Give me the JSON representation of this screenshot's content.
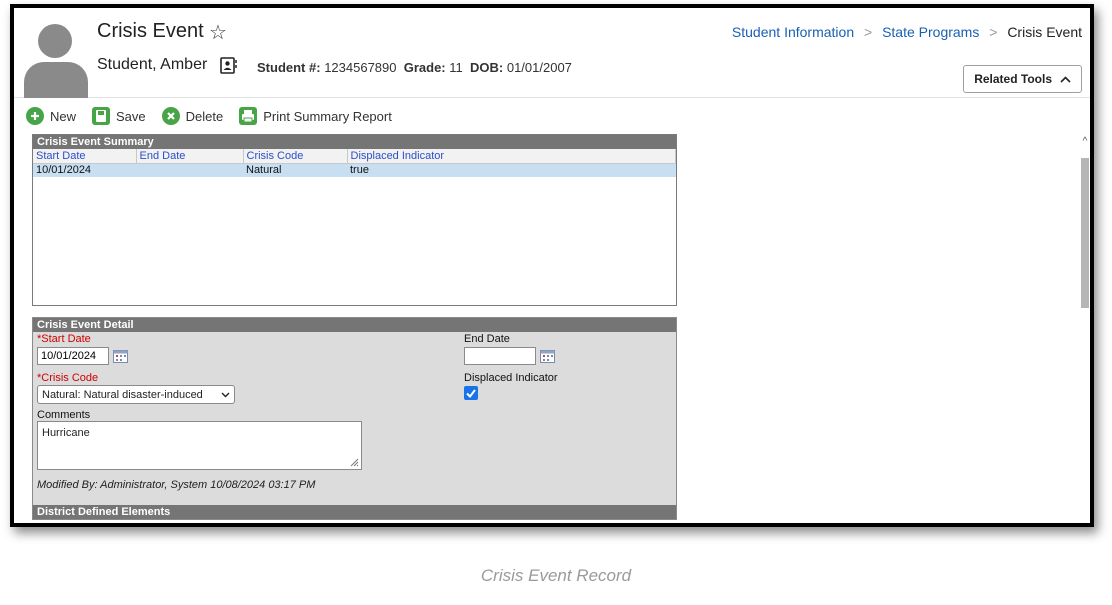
{
  "header": {
    "page_title": "Crisis Event",
    "student_name": "Student, Amber",
    "student_number_label": "Student #:",
    "student_number": "1234567890",
    "grade_label": "Grade:",
    "grade": "11",
    "dob_label": "DOB:",
    "dob": "01/01/2007",
    "breadcrumb": [
      "Student Information",
      "State Programs",
      "Crisis Event"
    ],
    "related_tools_label": "Related Tools"
  },
  "toolbar": {
    "new_label": "New",
    "save_label": "Save",
    "delete_label": "Delete",
    "print_label": "Print Summary Report"
  },
  "summary": {
    "title": "Crisis Event Summary",
    "columns": [
      "Start Date",
      "End Date",
      "Crisis Code",
      "Displaced Indicator"
    ],
    "rows": [
      [
        "10/01/2024",
        "",
        "Natural",
        "true"
      ]
    ]
  },
  "detail": {
    "title": "Crisis Event Detail",
    "start_date_label": "*Start Date",
    "start_date_value": "10/01/2024",
    "end_date_label": "End Date",
    "end_date_value": "",
    "crisis_code_label": "*Crisis Code",
    "crisis_code_value": "Natural: Natural disaster-induced",
    "displaced_label": "Displaced Indicator",
    "displaced_checked": true,
    "comments_label": "Comments",
    "comments_value": "Hurricane",
    "modified_by": "Modified By: Administrator, System 10/08/2024 03:17 PM",
    "district_title": "District Defined Elements"
  },
  "caption": "Crisis Event Record",
  "colors": {
    "accent_green": "#47a447",
    "link_blue": "#1a5fb4",
    "panel_header": "#757575",
    "selected_row": "#c8dff2",
    "required_red": "#d00000"
  }
}
